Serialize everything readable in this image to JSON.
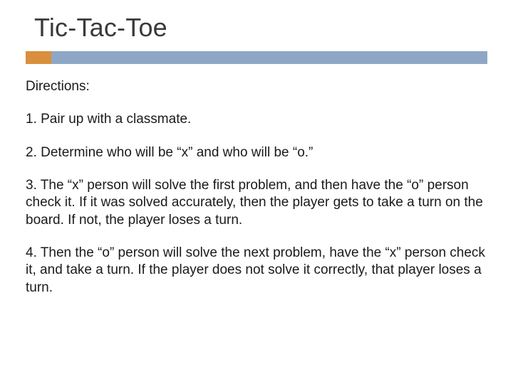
{
  "title": "Tic-Tac-Toe",
  "directions_label": "Directions:",
  "steps": {
    "s1": "1.  Pair up with a classmate.",
    "s2": "2. Determine who will be “x” and who will be “o.”",
    "s3": "3. The “x” person will solve the first problem, and then have the “o” person check it.  If it was solved accurately, then the player gets to take a turn on the board.  If not, the player loses a turn.",
    "s4": "4. Then the “o” person will solve the next problem, have the “x” person check it, and take a turn.  If the player does not solve it correctly, that player loses a turn."
  }
}
